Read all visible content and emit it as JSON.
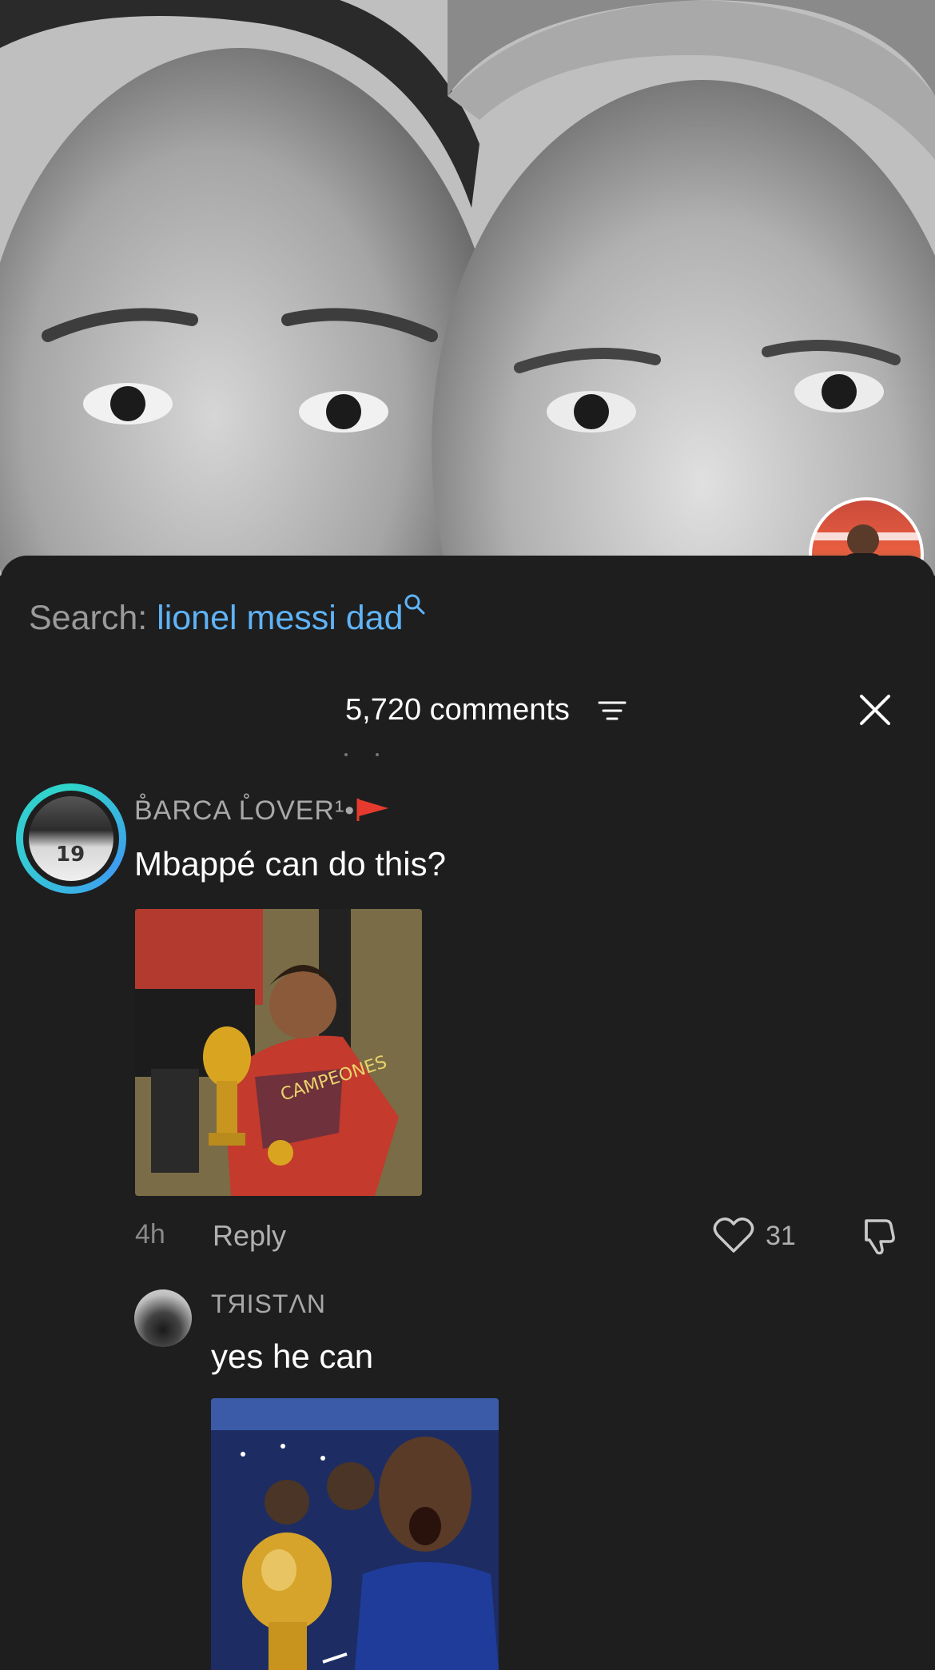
{
  "video": {
    "creator_avatar": "creator-avatar"
  },
  "search": {
    "label": "Search:",
    "query": "lionel messi dad",
    "icon": "search-icon"
  },
  "comments_header": {
    "count_label": "5,720 comments",
    "filter_icon": "filter-icon",
    "close_icon": "close-icon"
  },
  "comments": [
    {
      "username": "B̊ARCA L̊OVER¹•",
      "text": "Mbappé can do this?",
      "time": "4h",
      "reply_label": "Reply",
      "likes": "31",
      "avatar_jersey_number": "19"
    },
    {
      "username": "TЯISTΛN",
      "text": "yes he can"
    }
  ],
  "colors": {
    "sheet_bg": "#1e1e1f",
    "search_query": "#5fb3f6",
    "avatar_ring": "#2fd5c9",
    "muted_text": "#a8a8a8"
  }
}
